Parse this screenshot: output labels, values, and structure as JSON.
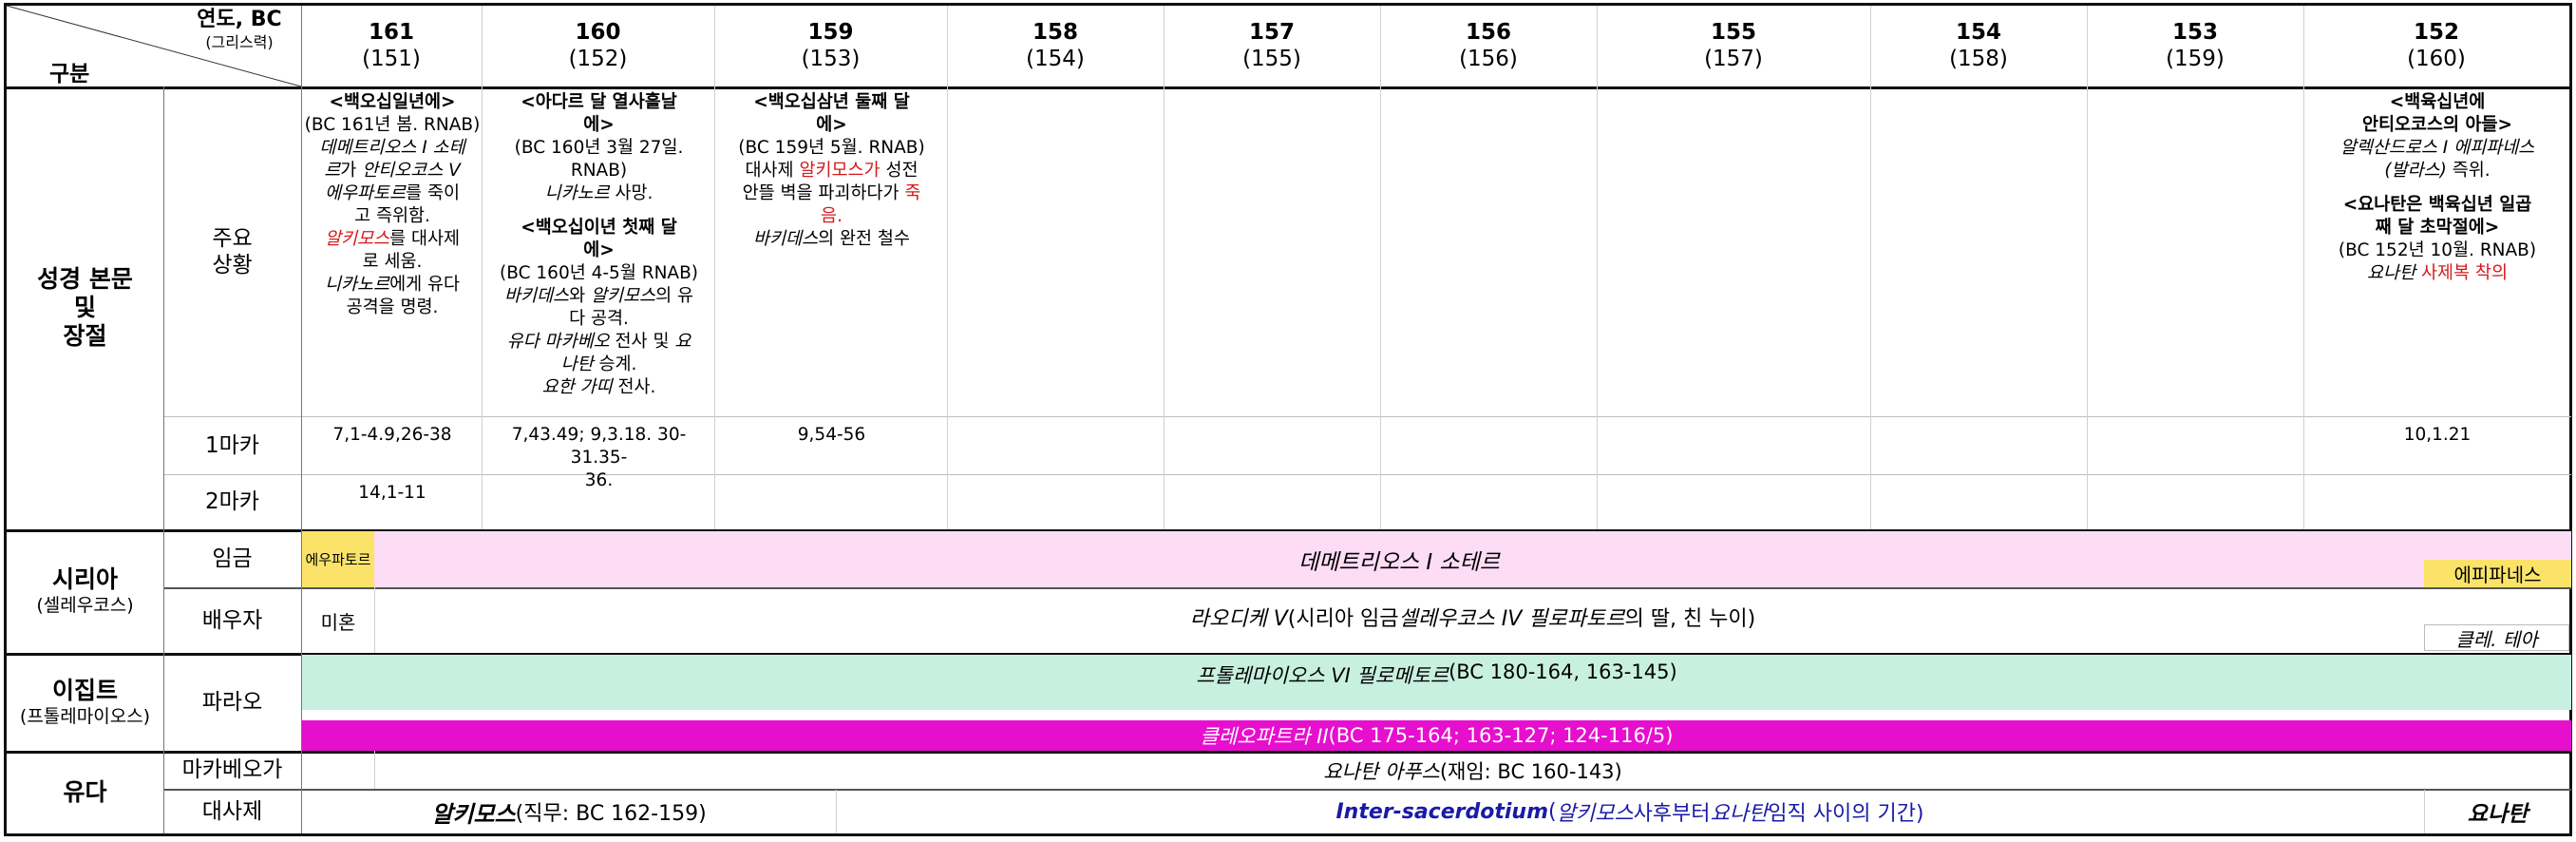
{
  "header": {
    "gubun": "구분",
    "year_label": "연도, BC",
    "greek_label": "(그리스력)",
    "years": [
      {
        "bc": "161",
        "greek": "(151)"
      },
      {
        "bc": "160",
        "greek": "(152)"
      },
      {
        "bc": "159",
        "greek": "(153)"
      },
      {
        "bc": "158",
        "greek": "(154)"
      },
      {
        "bc": "157",
        "greek": "(155)"
      },
      {
        "bc": "156",
        "greek": "(156)"
      },
      {
        "bc": "155",
        "greek": "(157)"
      },
      {
        "bc": "154",
        "greek": "(158)"
      },
      {
        "bc": "153",
        "greek": "(159)"
      },
      {
        "bc": "152",
        "greek": "(160)"
      }
    ]
  },
  "groups": {
    "bible": [
      "성경 본문",
      "및",
      "장절"
    ],
    "syria": {
      "title": "시리아",
      "sub": "(셀레우코스)"
    },
    "egypt": {
      "title": "이집트",
      "sub": "(프톨레마이오스)"
    },
    "judah": {
      "title": "유다"
    }
  },
  "rows": {
    "main_situation": [
      "주요",
      "상황"
    ],
    "maccabees1": "1마카",
    "maccabees2": "2마카",
    "king": "임금",
    "spouse": "배우자",
    "pharaoh": "파라오",
    "maccabean": "마카베오가",
    "high_priest": "대사제"
  },
  "main": {
    "y161": {
      "h1": "<백오십일년에>",
      "l1": "(BC 161년 봄. RNAB)",
      "l2a": "데메트리오스 I 소테",
      "l2b": "르",
      "l2c": "가 ",
      "l2d": "안티오코스 V",
      "l3": "에우파토르",
      "l3b": "를 죽이",
      "l4": "고 즉위함.",
      "l5a": "알키모스",
      "l5b": "를 대사제",
      "l6": "로 세움.",
      "l7a": "니카노르",
      "l7b": "에게 유다",
      "l8": "공격을 명령."
    },
    "y160": {
      "h1a": "<아다르 달 열사흘날",
      "h1b": "에>",
      "l1": "(BC 160년 3월 27일.",
      "l2": "RNAB)",
      "l3a": "니카노르",
      "l3b": " 사망.",
      "h2a": "<백오십이년 첫째 달",
      "h2b": "에>",
      "l4": "(BC 160년 4-5월 RNAB)",
      "l5a": "바키데스",
      "l5b": "와 ",
      "l5c": "알키모스",
      "l5d": "의 유",
      "l6": "다 공격.",
      "l7a": "유다 마카베오",
      "l7b": " 전사 및 ",
      "l7c": "요",
      "l8a": "나탄",
      "l8b": " 승계.",
      "l9a": "요한 가띠",
      "l9b": " 전사."
    },
    "y159": {
      "h1a": "<백오십삼년 둘째 달",
      "h1b": "에>",
      "l1": "(BC 159년 5월. RNAB)",
      "l2a": "대사제 ",
      "l2b": "알키모스가",
      "l2c": " 성전",
      "l3a": "안뜰 벽을 파괴하다가 ",
      "l3b": "죽",
      "l4": "음.",
      "l5a": "바키데스",
      "l5b": "의 완전 철수"
    },
    "y152": {
      "h1a": "<백육십년에",
      "h1b": "안티오코스의 아들>",
      "l1": "알렉산드로스 I 에피파네스",
      "l2a": "(발라스)",
      "l2b": " 즉위.",
      "h2a": "<요나탄은 백육십년 일곱",
      "h2b": "째 달 초막절에>",
      "l3": "(BC 152년 10월. RNAB)",
      "l4a": "요나탄 ",
      "l4b": "사제복 착의"
    }
  },
  "refs1": {
    "y161": "7,1-4.9,26-38",
    "y160a": "7,43.49; 9,3.18. 30-31.35-",
    "y160b": "36.",
    "y159": "9,54-56",
    "y152": "10,1.21"
  },
  "refs2": {
    "y161": "14,1-11"
  },
  "syria": {
    "eupator": "에우파토르",
    "demetrius": "데메트리오스 I 소테르",
    "epiphanes": "에피파네스",
    "unmarried": "미혼",
    "laodice_a": "라오디케 V",
    "laodice_b": " (시리아 임금 ",
    "laodice_c": "셀레우코스 IV 필로파토르",
    "laodice_d": "의 딸, 친 누이)",
    "cleo_thea": "클레. 테아"
  },
  "egypt": {
    "ptolemy_a": "프톨레마이오스 VI 필로메토르",
    "ptolemy_b": " (BC 180-164, 163-145)",
    "cleopatra_a": "클레오파트라 II",
    "cleopatra_b": " (BC 175-164; 163-127; 124-116/5)"
  },
  "judah": {
    "jonathan_apphus_a": "요나탄 아푸스",
    "jonathan_apphus_b": " (재임: BC 160-143)",
    "alcimus_a": "알키모스",
    "alcimus_b": " (직무: BC 162-159)",
    "inter_a": "Inter-sacerdotium",
    "inter_b": " (",
    "inter_c": "알키모스",
    "inter_d": " 사후부터 ",
    "inter_e": "요나탄",
    "inter_f": " 임직 사이의 기간)",
    "jonathan": "요나탄"
  },
  "colors": {
    "demetrius_bg": "#fddcf5",
    "eupator_bg": "#fbe36a",
    "epiphanes_bg": "#fbe36a",
    "ptolemy_bg": "#c8f0e0",
    "cleopatra_bg": "#e60fce",
    "red_text": "#d6191c",
    "blue_text": "#1a1aa8"
  }
}
